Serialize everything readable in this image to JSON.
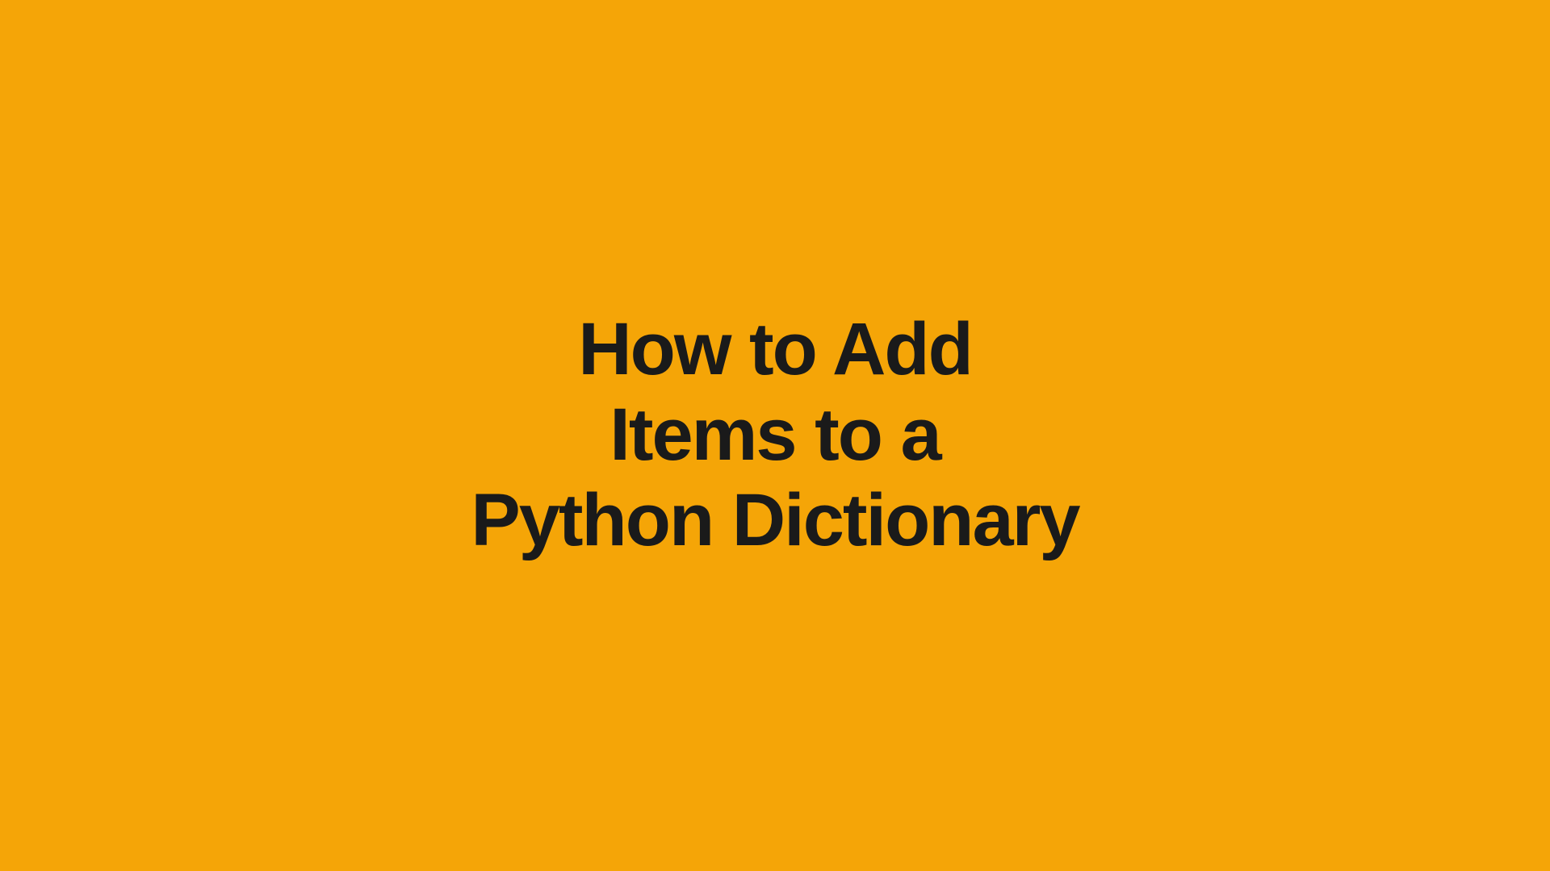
{
  "title": {
    "line1": "How to Add",
    "line2": "Items to a",
    "line3": "Python Dictionary"
  },
  "colors": {
    "background": "#f5a507",
    "text": "#1a1a1a"
  }
}
